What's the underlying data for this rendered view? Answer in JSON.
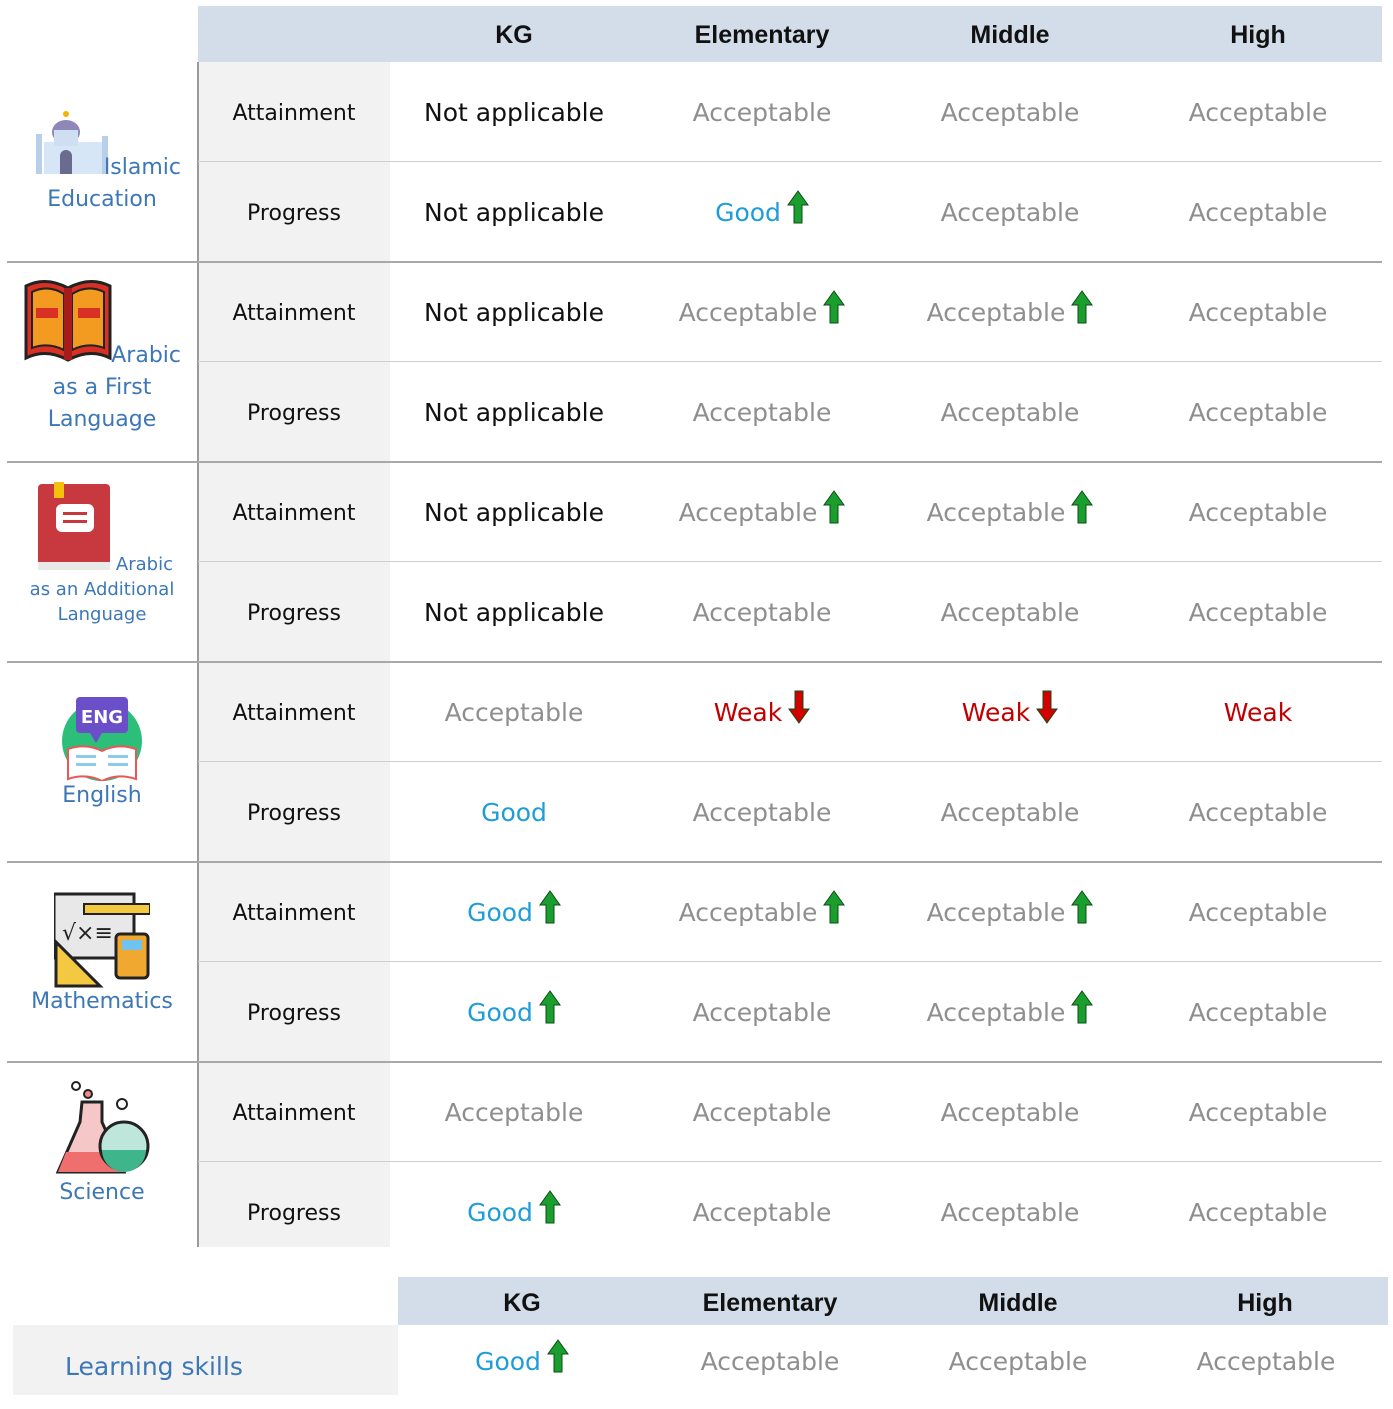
{
  "header": {
    "kg": "KG",
    "elementary": "Elementary",
    "middle": "Middle",
    "high": "High"
  },
  "labels": {
    "attainment": "Attainment",
    "progress": "Progress"
  },
  "subjects": [
    {
      "name_line1": "Islamic",
      "name_line2": "Education",
      "icon": "mosque-icon",
      "rows": [
        {
          "kind": "Attainment",
          "cells": [
            {
              "text": "Not applicable",
              "tone": "na",
              "arrow": ""
            },
            {
              "text": "Acceptable",
              "tone": "acc",
              "arrow": ""
            },
            {
              "text": "Acceptable",
              "tone": "acc",
              "arrow": ""
            },
            {
              "text": "Acceptable",
              "tone": "acc",
              "arrow": ""
            }
          ]
        },
        {
          "kind": "Progress",
          "cells": [
            {
              "text": "Not applicable",
              "tone": "na",
              "arrow": ""
            },
            {
              "text": "Good",
              "tone": "good",
              "arrow": "up"
            },
            {
              "text": "Acceptable",
              "tone": "acc",
              "arrow": ""
            },
            {
              "text": "Acceptable",
              "tone": "acc",
              "arrow": ""
            }
          ]
        }
      ]
    },
    {
      "name_line1": "Arabic",
      "name_line2": "as a First",
      "name_line3": "Language",
      "icon": "open-book-icon",
      "rows": [
        {
          "kind": "Attainment",
          "cells": [
            {
              "text": "Not applicable",
              "tone": "na",
              "arrow": ""
            },
            {
              "text": "Acceptable",
              "tone": "acc",
              "arrow": "up"
            },
            {
              "text": "Acceptable",
              "tone": "acc",
              "arrow": "up"
            },
            {
              "text": "Acceptable",
              "tone": "acc",
              "arrow": ""
            }
          ]
        },
        {
          "kind": "Progress",
          "cells": [
            {
              "text": "Not applicable",
              "tone": "na",
              "arrow": ""
            },
            {
              "text": "Acceptable",
              "tone": "acc",
              "arrow": ""
            },
            {
              "text": "Acceptable",
              "tone": "acc",
              "arrow": ""
            },
            {
              "text": "Acceptable",
              "tone": "acc",
              "arrow": ""
            }
          ]
        }
      ]
    },
    {
      "name_line1": "Arabic",
      "name_line2": "as an Additional",
      "name_line3": "Language",
      "icon": "closed-book-icon",
      "rows": [
        {
          "kind": "Attainment",
          "cells": [
            {
              "text": "Not applicable",
              "tone": "na",
              "arrow": ""
            },
            {
              "text": "Acceptable",
              "tone": "acc",
              "arrow": "up"
            },
            {
              "text": "Acceptable",
              "tone": "acc",
              "arrow": "up"
            },
            {
              "text": "Acceptable",
              "tone": "acc",
              "arrow": ""
            }
          ]
        },
        {
          "kind": "Progress",
          "cells": [
            {
              "text": "Not applicable",
              "tone": "na",
              "arrow": ""
            },
            {
              "text": "Acceptable",
              "tone": "acc",
              "arrow": ""
            },
            {
              "text": "Acceptable",
              "tone": "acc",
              "arrow": ""
            },
            {
              "text": "Acceptable",
              "tone": "acc",
              "arrow": ""
            }
          ]
        }
      ]
    },
    {
      "name_line1": "English",
      "icon": "eng-speech-book-icon",
      "icon_text": "ENG",
      "rows": [
        {
          "kind": "Attainment",
          "cells": [
            {
              "text": "Acceptable",
              "tone": "acc",
              "arrow": ""
            },
            {
              "text": "Weak",
              "tone": "weak",
              "arrow": "down"
            },
            {
              "text": "Weak",
              "tone": "weak",
              "arrow": "down"
            },
            {
              "text": "Weak",
              "tone": "weak",
              "arrow": ""
            }
          ]
        },
        {
          "kind": "Progress",
          "cells": [
            {
              "text": "Good",
              "tone": "good",
              "arrow": ""
            },
            {
              "text": "Acceptable",
              "tone": "acc",
              "arrow": ""
            },
            {
              "text": "Acceptable",
              "tone": "acc",
              "arrow": ""
            },
            {
              "text": "Acceptable",
              "tone": "acc",
              "arrow": ""
            }
          ]
        }
      ]
    },
    {
      "name_line1": "Mathematics",
      "icon": "math-board-calculator-icon",
      "rows": [
        {
          "kind": "Attainment",
          "cells": [
            {
              "text": "Good",
              "tone": "good",
              "arrow": "up"
            },
            {
              "text": "Acceptable",
              "tone": "acc",
              "arrow": "up"
            },
            {
              "text": "Acceptable",
              "tone": "acc",
              "arrow": "up"
            },
            {
              "text": "Acceptable",
              "tone": "acc",
              "arrow": ""
            }
          ]
        },
        {
          "kind": "Progress",
          "cells": [
            {
              "text": "Good",
              "tone": "good",
              "arrow": "up"
            },
            {
              "text": "Acceptable",
              "tone": "acc",
              "arrow": ""
            },
            {
              "text": "Acceptable",
              "tone": "acc",
              "arrow": "up"
            },
            {
              "text": "Acceptable",
              "tone": "acc",
              "arrow": ""
            }
          ]
        }
      ]
    },
    {
      "name_line1": "Science",
      "icon": "lab-flasks-icon",
      "rows": [
        {
          "kind": "Attainment",
          "cells": [
            {
              "text": "Acceptable",
              "tone": "acc",
              "arrow": ""
            },
            {
              "text": "Acceptable",
              "tone": "acc",
              "arrow": ""
            },
            {
              "text": "Acceptable",
              "tone": "acc",
              "arrow": ""
            },
            {
              "text": "Acceptable",
              "tone": "acc",
              "arrow": ""
            }
          ]
        },
        {
          "kind": "Progress",
          "cells": [
            {
              "text": "Good",
              "tone": "good",
              "arrow": "up"
            },
            {
              "text": "Acceptable",
              "tone": "acc",
              "arrow": ""
            },
            {
              "text": "Acceptable",
              "tone": "acc",
              "arrow": ""
            },
            {
              "text": "Acceptable",
              "tone": "acc",
              "arrow": ""
            }
          ]
        }
      ]
    }
  ],
  "learning_skills": {
    "label": "Learning skills",
    "cells": [
      {
        "text": "Good",
        "tone": "good",
        "arrow": "up"
      },
      {
        "text": "Acceptable",
        "tone": "acc",
        "arrow": ""
      },
      {
        "text": "Acceptable",
        "tone": "acc",
        "arrow": ""
      },
      {
        "text": "Acceptable",
        "tone": "acc",
        "arrow": ""
      }
    ]
  },
  "colors": {
    "header_bg": "#d2dde9",
    "na": "#111111",
    "acceptable": "#8f8f8f",
    "good": "#1f9dd9",
    "weak": "#c00000",
    "up_arrow": "#1a9e2e",
    "down_arrow": "#d40000",
    "subject": "#3d77b6"
  }
}
